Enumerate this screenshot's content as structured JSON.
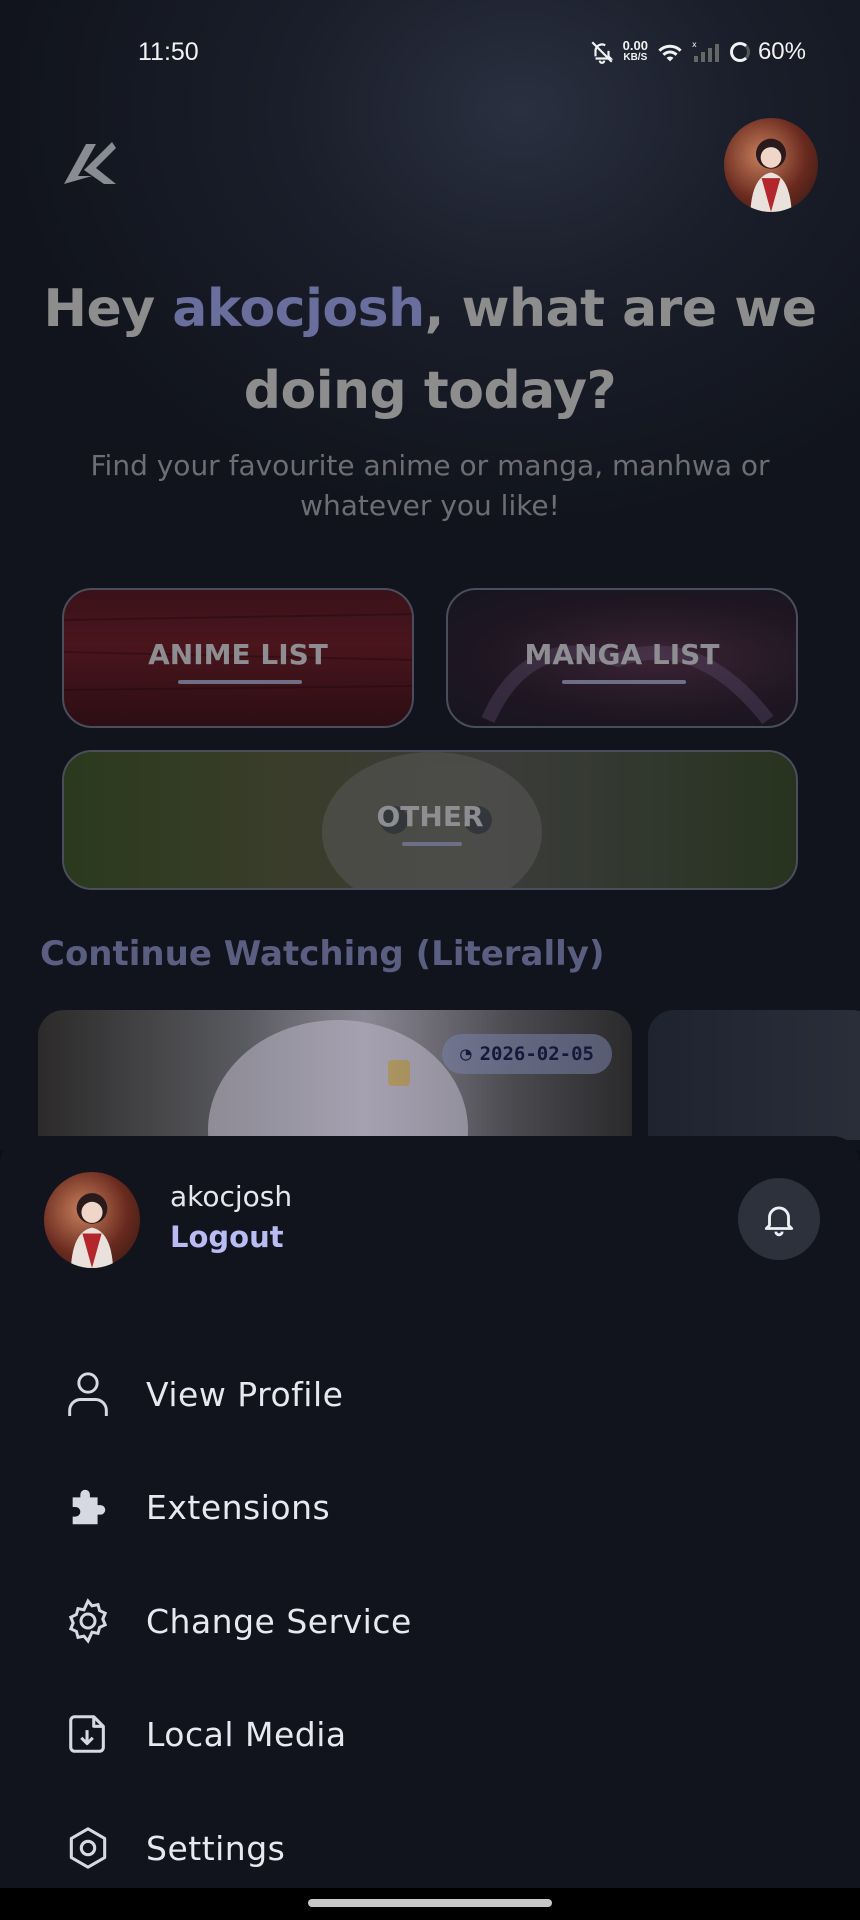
{
  "status_bar": {
    "time": "11:50",
    "net_speed_value": "0.00",
    "net_speed_unit": "KB/S",
    "battery": "60%"
  },
  "header": {
    "logo_icon": "app-logo-icon",
    "avatar_icon": "user-avatar"
  },
  "hero": {
    "greeting_prefix": "Hey ",
    "username": "akocjosh",
    "greeting_suffix": ", what are we doing today?",
    "subtitle": "Find your favourite anime or manga, manhwa or whatever you like!"
  },
  "cards": {
    "anime": "ANIME LIST",
    "manga": "MANGA LIST",
    "other": "OTHER"
  },
  "continue_watching": {
    "title": "Continue Watching (Literally)",
    "items": [
      {
        "date": "2026-02-05"
      }
    ]
  },
  "sheet": {
    "username": "akocjosh",
    "logout": "Logout",
    "menu": [
      {
        "label": "View Profile",
        "icon": "person-icon"
      },
      {
        "label": "Extensions",
        "icon": "puzzle-icon"
      },
      {
        "label": "Change Service",
        "icon": "gear-sparkle-icon"
      },
      {
        "label": "Local Media",
        "icon": "download-file-icon"
      },
      {
        "label": "Settings",
        "icon": "hexagon-settings-icon"
      }
    ]
  },
  "colors": {
    "accent": "#b9bcf2",
    "username_highlight": "#6a6e9c",
    "sheet_bg": "#11141d"
  }
}
